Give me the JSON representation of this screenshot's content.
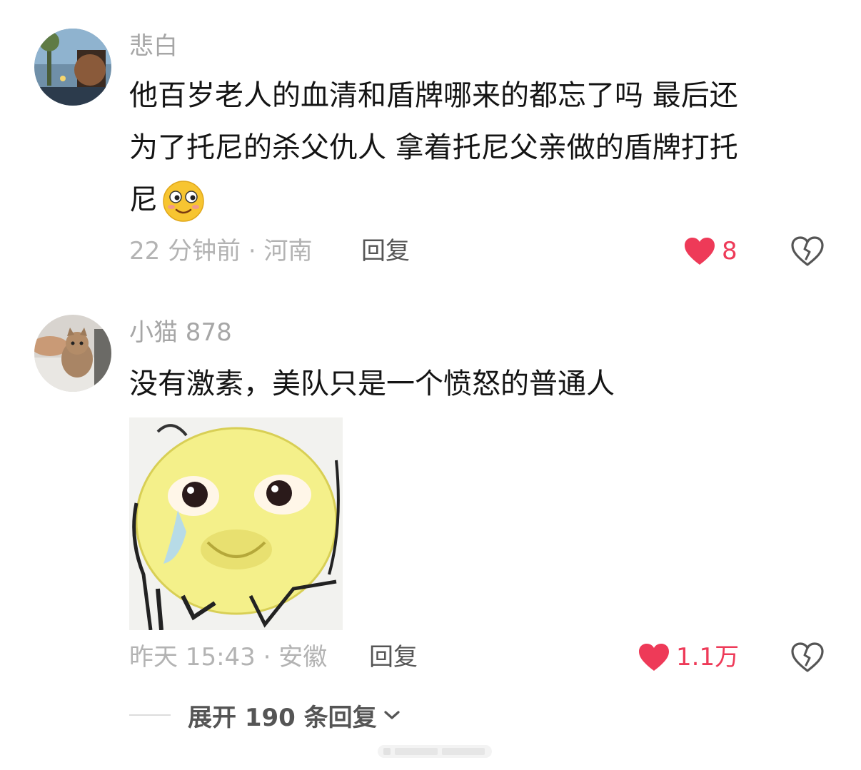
{
  "comments": [
    {
      "username": "悲白",
      "text_lines": [
        "他百岁老人的血清和盾牌哪来的都忘了吗 最后还",
        "为了托尼的杀父仇人 拿着托尼父亲做的盾牌打托",
        "尼"
      ],
      "emoji_icon": "shy-smile-emoji-icon",
      "meta": "22 分钟前 · 河南",
      "reply_label": "回复",
      "like_count": "8",
      "avatar_icon": "landscape-avatar"
    },
    {
      "username": "小猫 878",
      "text_lines": [
        "没有激素，美队只是一个愤怒的普通人"
      ],
      "sticker_icon": "crying-laughing-sticker",
      "meta": "昨天 15:43 · 安徽",
      "reply_label": "回复",
      "like_count": "1.1万",
      "avatar_icon": "cat-avatar"
    }
  ],
  "expand_replies": {
    "label": "展开 190 条回复",
    "icon": "chevron-down-icon"
  },
  "colors": {
    "like_red": "#ee3a58",
    "meta_gray": "#b3b3b3",
    "name_gray": "#a6a6a6",
    "text": "#141414"
  }
}
